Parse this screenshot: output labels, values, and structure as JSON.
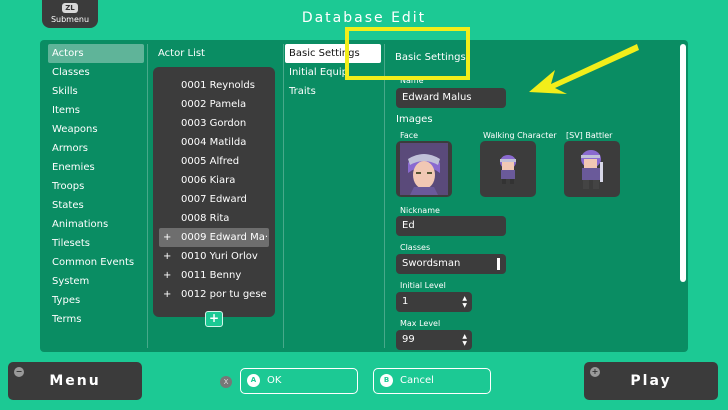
{
  "header": {
    "submenu_badge": "ZL",
    "submenu_label": "Submenu",
    "title": "Database Edit"
  },
  "categories": [
    {
      "label": "Actors",
      "active": true
    },
    {
      "label": "Classes"
    },
    {
      "label": "Skills"
    },
    {
      "label": "Items"
    },
    {
      "label": "Weapons"
    },
    {
      "label": "Armors"
    },
    {
      "label": "Enemies"
    },
    {
      "label": "Troops"
    },
    {
      "label": "States"
    },
    {
      "label": "Animations"
    },
    {
      "label": "Tilesets"
    },
    {
      "label": "Common Events"
    },
    {
      "label": "System"
    },
    {
      "label": "Types"
    },
    {
      "label": "Terms"
    }
  ],
  "actor_list": {
    "header": "Actor List",
    "items": [
      {
        "label": "0001 Reynolds",
        "plus": ""
      },
      {
        "label": "0002 Pamela",
        "plus": ""
      },
      {
        "label": "0003 Gordon",
        "plus": ""
      },
      {
        "label": "0004 Matilda",
        "plus": ""
      },
      {
        "label": "0005 Alfred",
        "plus": ""
      },
      {
        "label": "0006 Kiara",
        "plus": ""
      },
      {
        "label": "0007 Edward",
        "plus": ""
      },
      {
        "label": "0008 Rita",
        "plus": ""
      },
      {
        "label": "0009 Edward Ma···",
        "plus": "+",
        "selected": true
      },
      {
        "label": "0010 Yuri Orlov",
        "plus": "+"
      },
      {
        "label": "0011 Benny",
        "plus": "+"
      },
      {
        "label": "0012 por tu gese",
        "plus": "+"
      }
    ],
    "add_label": "+"
  },
  "tabs": [
    {
      "label": "Basic Settings",
      "active": true
    },
    {
      "label": "Initial Equip"
    },
    {
      "label": "Traits"
    }
  ],
  "detail": {
    "header": "Basic Settings",
    "name_label": "Name",
    "name_value": "Edward Malus",
    "images_label": "Images",
    "face_label": "Face",
    "walking_label": "Walking Character",
    "battler_label": "[SV] Battler",
    "nickname_label": "Nickname",
    "nickname_value": "Ed",
    "classes_label": "Classes",
    "classes_value": "Swordsman",
    "initial_level_label": "Initial Level",
    "initial_level_value": "1",
    "max_level_label": "Max Level",
    "max_level_value": "99",
    "stepper_up": "▲",
    "stepper_down": "▼"
  },
  "footer": {
    "menu_label": "Menu",
    "menu_icon": "−",
    "play_label": "Play",
    "play_icon": "+",
    "x_badge": "X",
    "ok_badge": "A",
    "ok_label": "OK",
    "cancel_badge": "B",
    "cancel_label": "Cancel"
  },
  "colors": {
    "background": "#1cc994",
    "panel": "#0a8d63",
    "dark": "#3c3c3c",
    "highlight": "#f2ee1a"
  }
}
